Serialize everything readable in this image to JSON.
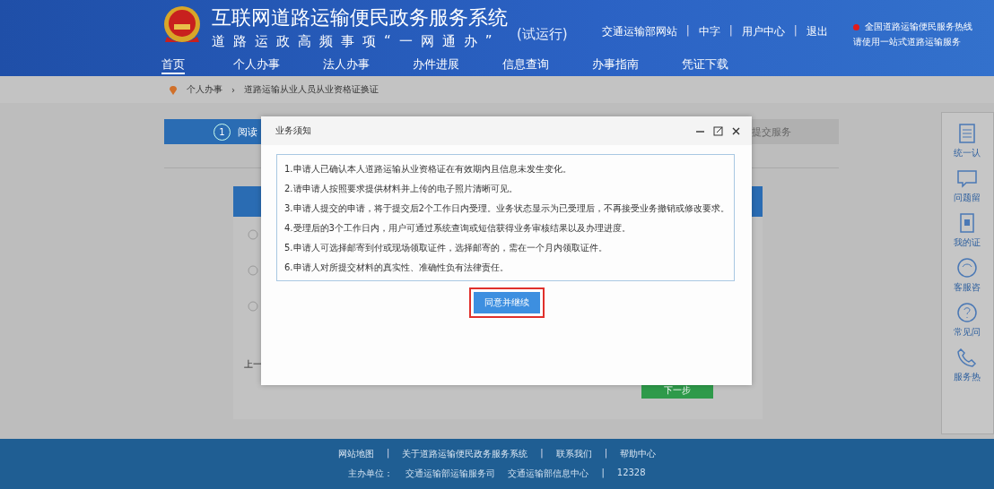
{
  "header": {
    "title": "互联网道路运输便民政务服务系统",
    "subtitle": "道路运政高频事项“一网通办”",
    "trial_tag": "(试运行)",
    "top_links": [
      "交通运输部网站",
      "|",
      "中字",
      "|",
      "用户中心",
      "|",
      "退出"
    ],
    "notice": [
      "全国道路运输便民服务热线",
      "请使用一站式道路运输服务"
    ]
  },
  "nav": [
    {
      "label": "首页",
      "selected": true
    },
    {
      "label": "个人办事",
      "selected": false
    },
    {
      "label": "法人办事",
      "selected": false
    },
    {
      "label": "办件进展",
      "selected": false
    },
    {
      "label": "信息查询",
      "selected": false
    },
    {
      "label": "办事指南",
      "selected": false
    },
    {
      "label": "凭证下载",
      "selected": false
    }
  ],
  "breadcrumb": [
    "个人办事",
    "›",
    "道路运输从业人员从业资格证换证"
  ],
  "steps": [
    {
      "number": "1",
      "label": "阅读",
      "selected": true
    },
    {
      "label": "提交服务",
      "selected": false
    }
  ],
  "form": {
    "prev": "上一",
    "next": "下一步"
  },
  "sidebar": [
    {
      "kind": "document",
      "label": "统一认"
    },
    {
      "kind": "chat",
      "label": "问题留"
    },
    {
      "kind": "card",
      "label": "我的证"
    },
    {
      "kind": "service",
      "label": "客服咨"
    },
    {
      "kind": "question",
      "label": "常见问"
    },
    {
      "kind": "phone",
      "label": "服务热"
    }
  ],
  "modal": {
    "title": "业务须知",
    "items": [
      "1.申请人已确认本人道路运输从业资格证在有效期内且信息未发生变化。",
      "2.请申请人按照要求提供材料并上传的电子照片清晰可见。",
      "3.申请人提交的申请，将于提交后2个工作日内受理。业务状态显示为已受理后，不再接受业务撤销或修改要求。",
      "4.受理后的3个工作日内，用户可通过系统查询或短信获得业务审核结果以及办理进度。",
      "5.申请人可选择邮寄到付或现场领取证件，选择邮寄的，需在一个月内领取证件。",
      "6.申请人对所提交材料的真实性、准确性负有法律责任。"
    ],
    "button": "同意并继续"
  },
  "footer": {
    "links": [
      "网站地图",
      "|",
      "关于道路运输便民政务服务系统",
      "|",
      "联系我们",
      "|",
      "帮助中心"
    ],
    "credits": [
      "主办单位：",
      "交通运输部运输服务司",
      "交通运输部信息中心",
      "|",
      "12328"
    ]
  }
}
